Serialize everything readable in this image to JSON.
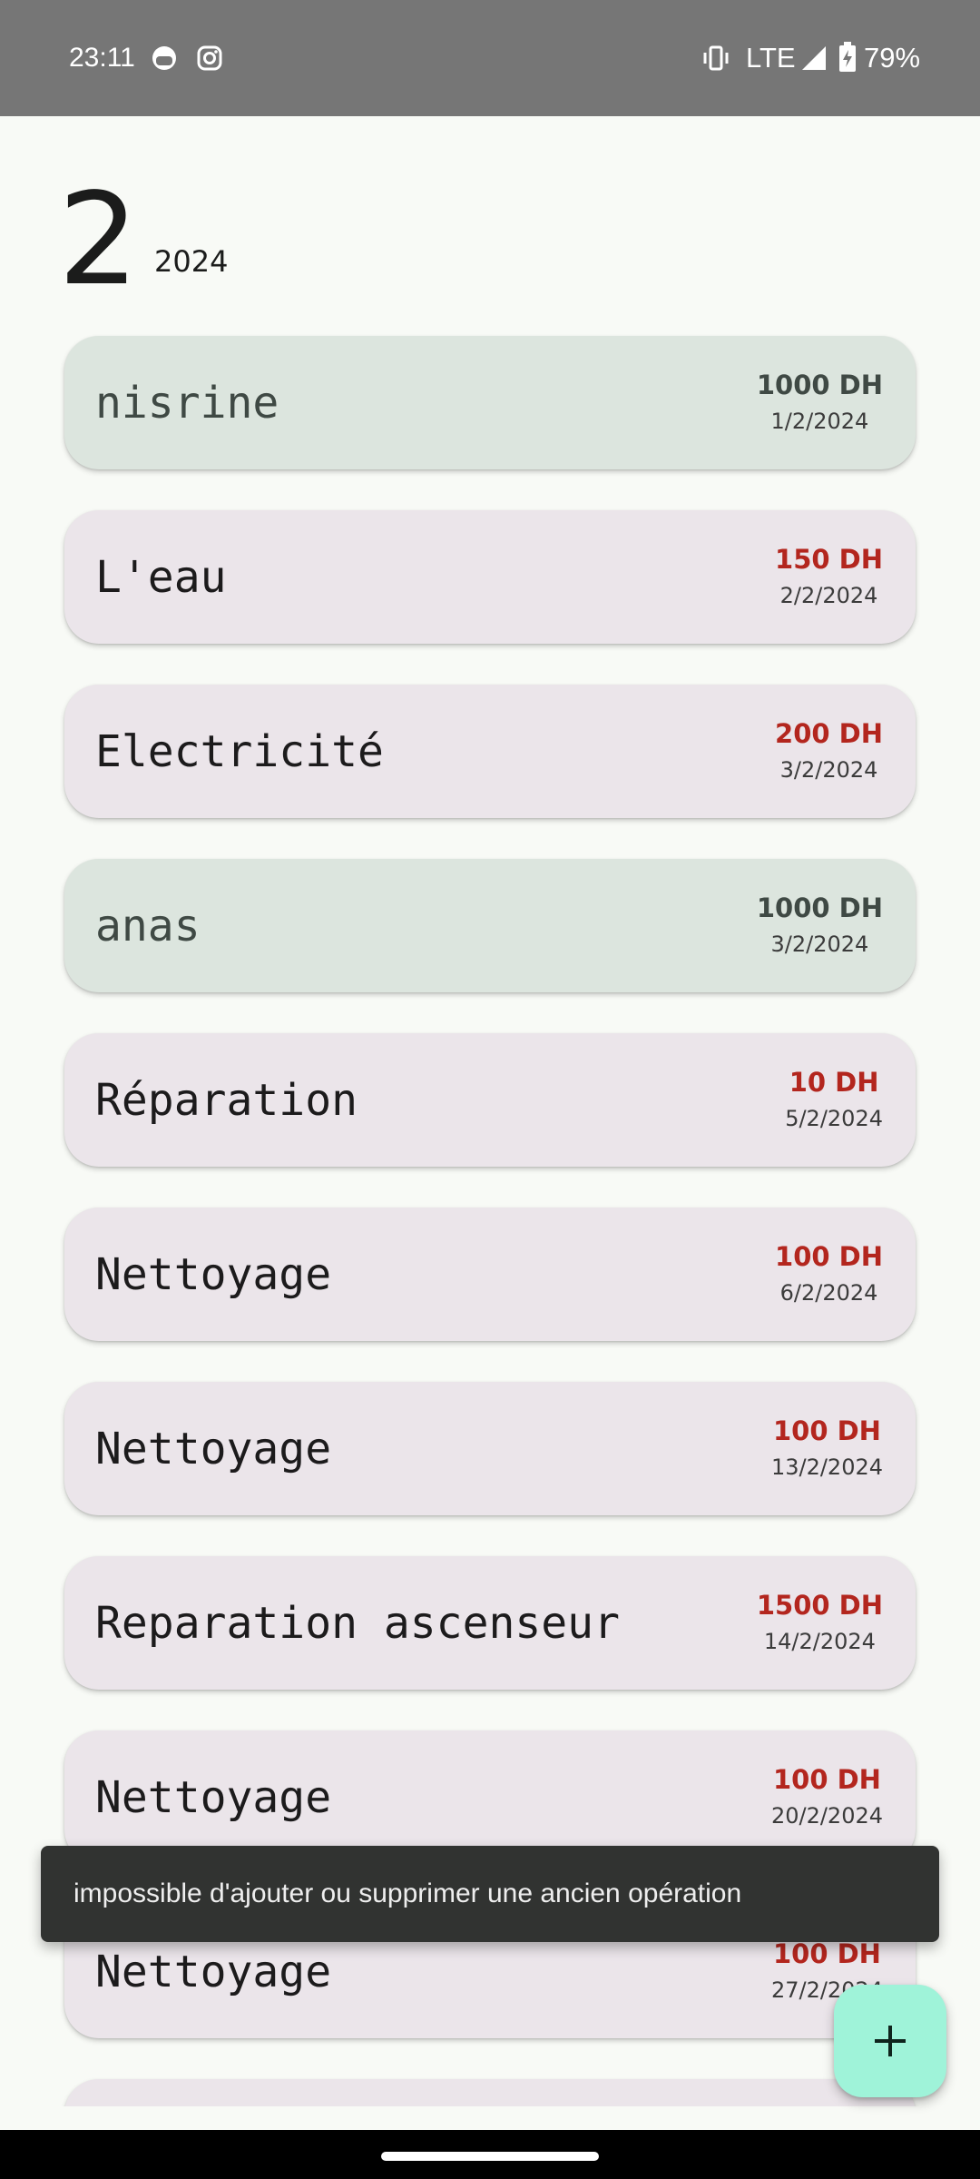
{
  "status_bar": {
    "time": "23:11",
    "network": "LTE",
    "battery": "79%",
    "icons": [
      "face-notification-icon",
      "instagram-icon",
      "vibrate-icon",
      "signal-icon",
      "battery-charging-icon"
    ]
  },
  "header": {
    "month": "2",
    "year": "2024"
  },
  "transactions": [
    {
      "type": "income",
      "title": "nisrine",
      "amount": "1000 DH",
      "date": "1/2/2024"
    },
    {
      "type": "expense",
      "title": "L'eau",
      "amount": "150 DH",
      "date": "2/2/2024"
    },
    {
      "type": "expense",
      "title": "Electricité",
      "amount": "200 DH",
      "date": "3/2/2024"
    },
    {
      "type": "income",
      "title": "anas",
      "amount": "1000 DH",
      "date": "3/2/2024"
    },
    {
      "type": "expense",
      "title": "Réparation",
      "amount": "10 DH",
      "date": "5/2/2024"
    },
    {
      "type": "expense",
      "title": "Nettoyage",
      "amount": "100 DH",
      "date": "6/2/2024"
    },
    {
      "type": "expense",
      "title": "Nettoyage",
      "amount": "100 DH",
      "date": "13/2/2024"
    },
    {
      "type": "expense",
      "title": "Reparation ascenseur",
      "amount": "1500 DH",
      "date": "14/2/2024"
    },
    {
      "type": "expense",
      "title": "Nettoyage",
      "amount": "100 DH",
      "date": "20/2/2024"
    },
    {
      "type": "expense",
      "title": "Nettoyage",
      "amount": "100 DH",
      "date": "27/2/2024"
    },
    {
      "type": "expense",
      "title": "",
      "amount": "",
      "date": ""
    }
  ],
  "snackbar": {
    "message": "impossible d'ajouter ou supprimer une ancien opération"
  },
  "fab": {
    "icon": "plus-icon"
  },
  "colors": {
    "background": "#f8faf6",
    "expense_card": "#ebe5ea",
    "income_card": "#dce5de",
    "expense_amount": "#b3261e",
    "income_amount": "#3f4944",
    "fab": "#9ff3d9",
    "status_bar": "#767676"
  }
}
